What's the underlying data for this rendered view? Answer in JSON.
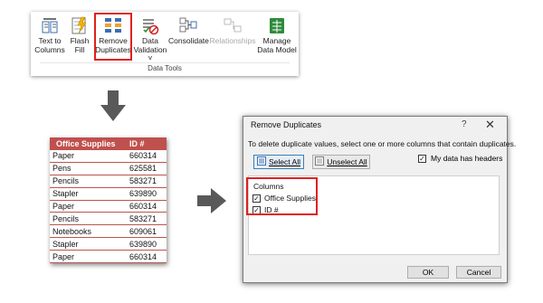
{
  "ribbon": {
    "group_label": "Data Tools",
    "buttons": [
      {
        "line1": "Text to",
        "line2": "Columns",
        "icon": "text-to-columns-icon"
      },
      {
        "line1": "Flash",
        "line2": "Fill",
        "icon": "flash-fill-icon"
      },
      {
        "line1": "Remove",
        "line2": "Duplicates",
        "icon": "remove-duplicates-icon"
      },
      {
        "line1": "Data",
        "line2": "Validation ˅",
        "icon": "data-validation-icon"
      },
      {
        "line1": "Consolidate",
        "line2": "",
        "icon": "consolidate-icon"
      },
      {
        "line1": "Relationships",
        "line2": "",
        "icon": "relationships-icon"
      },
      {
        "line1": "Manage",
        "line2": "Data Model",
        "icon": "manage-data-model-icon"
      }
    ]
  },
  "table": {
    "headers": [
      "Office Supplies",
      "ID #"
    ],
    "rows": [
      [
        "Paper",
        "660314"
      ],
      [
        "Pens",
        "625581"
      ],
      [
        "Pencils",
        "583271"
      ],
      [
        "Stapler",
        "639890"
      ],
      [
        "Paper",
        "660314"
      ],
      [
        "Pencils",
        "583271"
      ],
      [
        "Notebooks",
        "609061"
      ],
      [
        "Stapler",
        "639890"
      ],
      [
        "Paper",
        "660314"
      ]
    ]
  },
  "dialog": {
    "title": "Remove Duplicates",
    "help": "?",
    "close": "✕",
    "instruction": "To delete duplicate values, select one or more columns that contain duplicates.",
    "select_all": "Select All",
    "unselect_all": "Unselect All",
    "headers_checkbox": "My data has headers",
    "columns_label": "Columns",
    "columns": [
      "Office Supplies",
      "ID #"
    ],
    "ok": "OK",
    "cancel": "Cancel"
  },
  "colors": {
    "table_header": "#c0504d",
    "highlight": "#e0201d",
    "arrow": "#595959"
  }
}
